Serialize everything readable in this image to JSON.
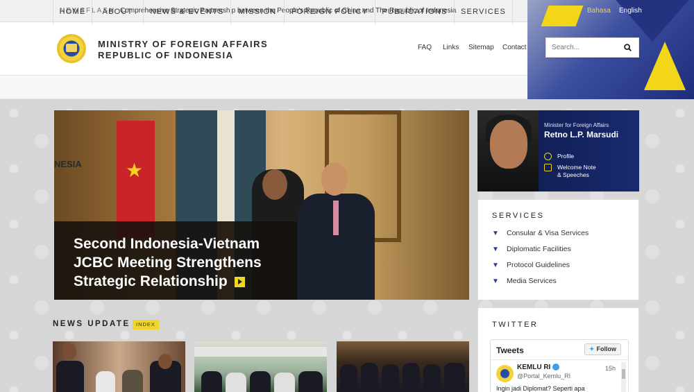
{
  "topbar": {
    "newsflash_label": "NEWSFLASH",
    "newsflash_text": "Comprehensive Strategic Partnership between the People's Republic of China and The Republic of Indonesia",
    "lang_bahasa": "Bahasa",
    "lang_english": "English"
  },
  "header": {
    "title_line1": "MINISTRY OF FOREIGN AFFAIRS",
    "title_line2": "REPUBLIC OF INDONESIA",
    "links": [
      "FAQ",
      "Links",
      "Sitemap",
      "Contact"
    ],
    "search_placeholder": "Search..."
  },
  "nav": {
    "items": [
      "HOME",
      "ABOUT",
      "NEWS & EVENTS",
      "MISSION",
      "FOREIGN POLICY",
      "PUBLICATIONS",
      "SERVICES"
    ]
  },
  "hero": {
    "photo_label": "NESIA",
    "title": "Second Indonesia-Vietnam JCBC Meeting Strengthens Strategic Relationship"
  },
  "minister": {
    "role": "Minister for Foreign Affairs",
    "name": "Retno L.P. Marsudi",
    "profile": "Profile",
    "welcome_line1": "Welcome Note",
    "welcome_line2": "& Speeches"
  },
  "services": {
    "heading": "SERVICES",
    "items": [
      "Consular & Visa Services",
      "Diplomatic Facilities",
      "Protocol Guidelines",
      "Media Services"
    ]
  },
  "twitter": {
    "heading": "TWITTER",
    "tweets_label": "Tweets",
    "follow_label": "Follow",
    "account_name": "KEMLU RI",
    "handle": "@Portal_Kemlu_RI",
    "time": "15h",
    "tweet_text": "Ingin jadi Diplomat? Seperti apa"
  },
  "news": {
    "heading": "NEWS UPDATE",
    "index_label": "INDEX"
  },
  "colors": {
    "accent_yellow": "#f0d52a",
    "navy": "#182a6e",
    "twitter_blue": "#3aa3e3"
  }
}
